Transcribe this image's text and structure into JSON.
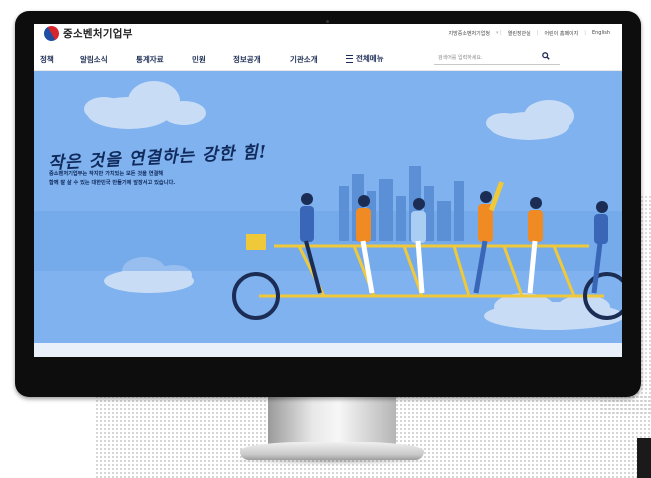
{
  "header": {
    "logo_text": "중소벤처기업부",
    "utility_links": [
      "지방중소벤처기업청",
      "열린장관실",
      "어린이 홈페이지",
      "English"
    ]
  },
  "nav": {
    "items": [
      "정책",
      "알림소식",
      "통계자료",
      "민원",
      "정보공개",
      "기관소개"
    ],
    "all_menu_label": "전체메뉴",
    "search_placeholder": "검색어를 입력하세요."
  },
  "hero": {
    "headline": "작은 것을 연결하는 강한 힘!",
    "subtext_line1": "중소벤처기업부는 작지만 가치있는 모든 것을 연결해",
    "subtext_line2": "함께 잘 살 수 있는 대한민국 만들기에 앞장서고 있습니다."
  },
  "colors": {
    "sky": "#7fb2ee",
    "navy": "#102a5c",
    "orange": "#f08a23",
    "bike_frame": "#f0c93a"
  },
  "icons": [
    "search-icon",
    "hamburger-icon",
    "government-logo-icon"
  ]
}
